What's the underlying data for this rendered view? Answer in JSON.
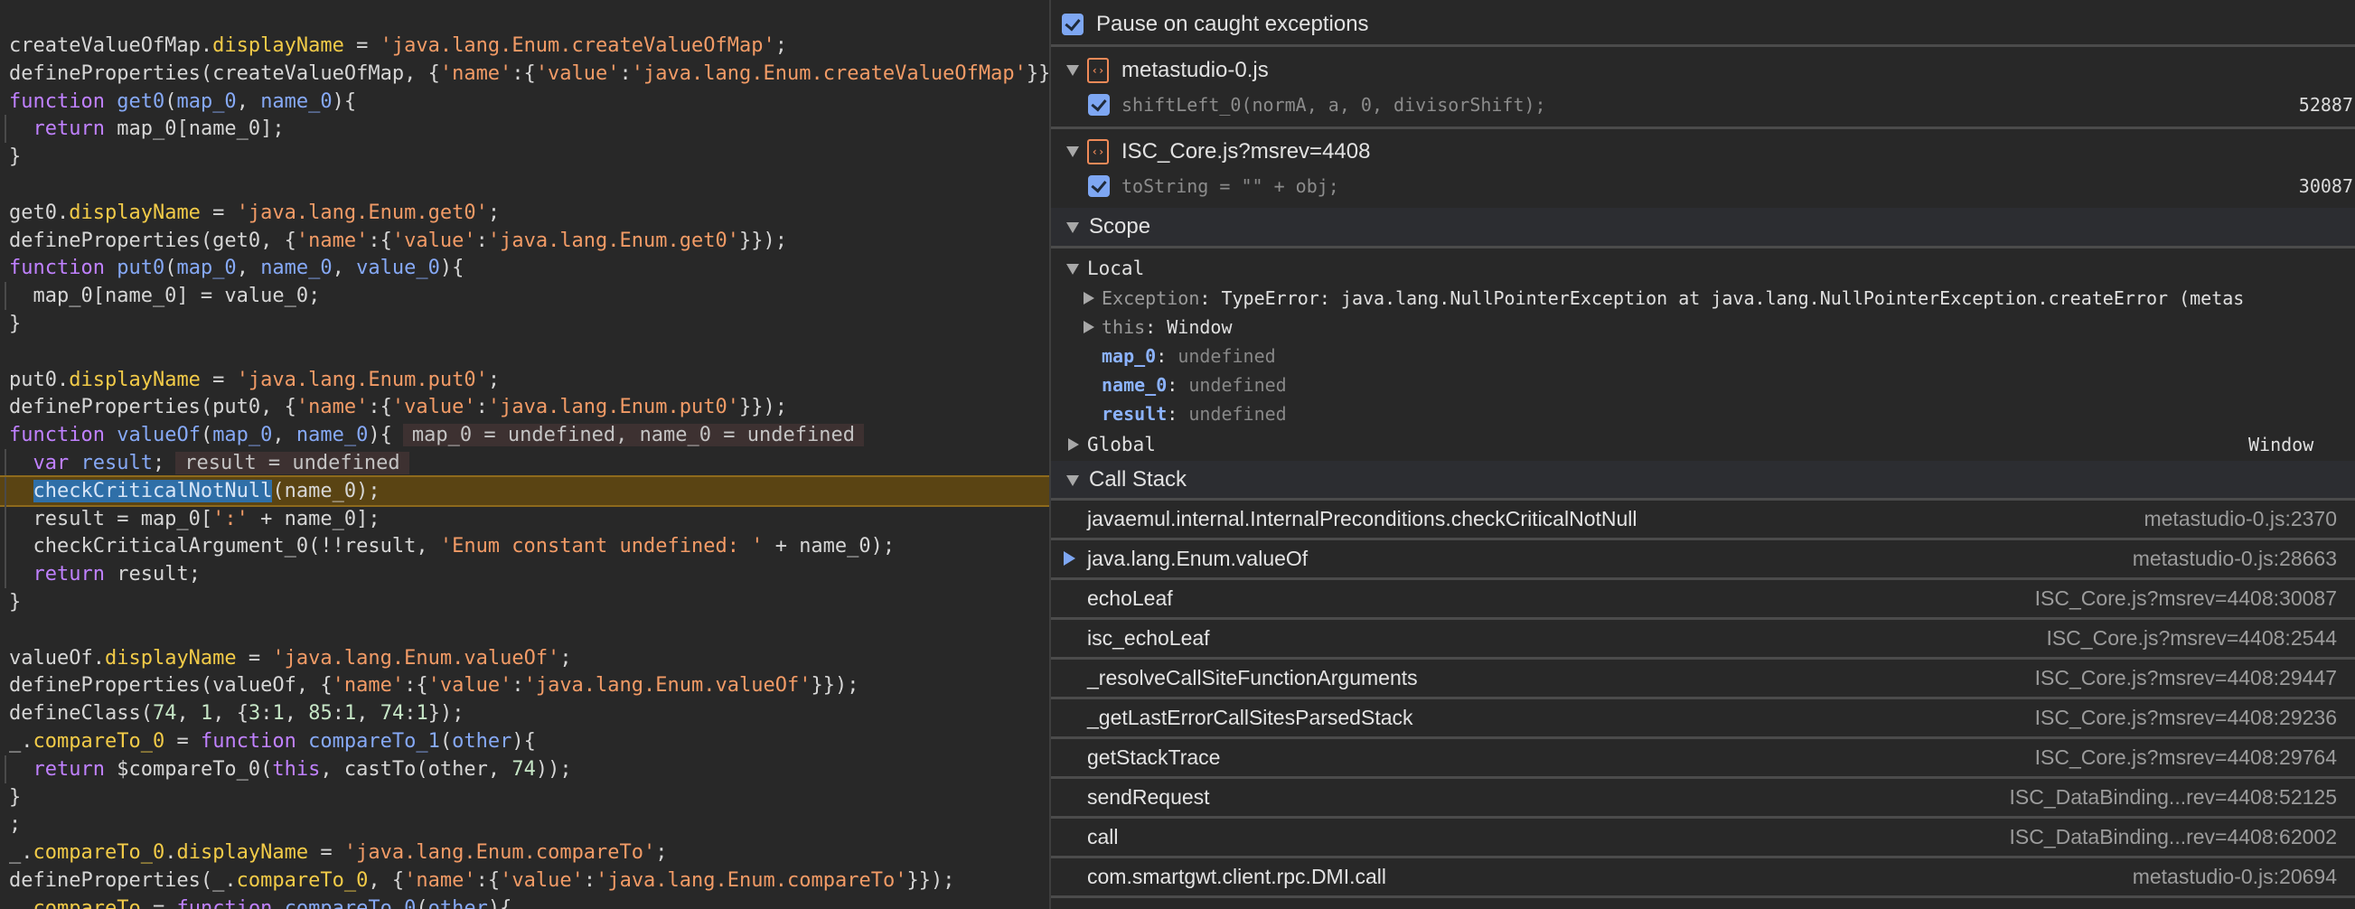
{
  "editor": {
    "executing_line_index": 16,
    "lines": [
      {
        "indent": false,
        "tokens": [
          [
            "p",
            "createValueOfMap."
          ],
          [
            "y",
            "displayName"
          ],
          [
            "p",
            " = "
          ],
          [
            "s",
            "'java.lang.Enum.createValueOfMap'"
          ],
          [
            "p",
            ";"
          ]
        ]
      },
      {
        "indent": false,
        "tokens": [
          [
            "p",
            "defineProperties(createValueOfMap, {"
          ],
          [
            "s",
            "'name'"
          ],
          [
            "p",
            ":{"
          ],
          [
            "s",
            "'value'"
          ],
          [
            "p",
            ":"
          ],
          [
            "s",
            "'java.lang.Enum.createValueOfMap'"
          ],
          [
            "p",
            "}});"
          ]
        ]
      },
      {
        "indent": false,
        "tokens": [
          [
            "k",
            "function "
          ],
          [
            "f",
            "get0"
          ],
          [
            "p",
            "("
          ],
          [
            "f",
            "map_0"
          ],
          [
            "p",
            ", "
          ],
          [
            "f",
            "name_0"
          ],
          [
            "p",
            "){"
          ]
        ]
      },
      {
        "indent": true,
        "tokens": [
          [
            "p",
            "  "
          ],
          [
            "k",
            "return"
          ],
          [
            "p",
            " map_0[name_0];"
          ]
        ]
      },
      {
        "indent": false,
        "tokens": [
          [
            "p",
            "}"
          ]
        ]
      },
      {
        "indent": false,
        "tokens": []
      },
      {
        "indent": false,
        "tokens": [
          [
            "p",
            "get0."
          ],
          [
            "y",
            "displayName"
          ],
          [
            "p",
            " = "
          ],
          [
            "s",
            "'java.lang.Enum.get0'"
          ],
          [
            "p",
            ";"
          ]
        ]
      },
      {
        "indent": false,
        "tokens": [
          [
            "p",
            "defineProperties(get0, {"
          ],
          [
            "s",
            "'name'"
          ],
          [
            "p",
            ":{"
          ],
          [
            "s",
            "'value'"
          ],
          [
            "p",
            ":"
          ],
          [
            "s",
            "'java.lang.Enum.get0'"
          ],
          [
            "p",
            "}});"
          ]
        ]
      },
      {
        "indent": false,
        "tokens": [
          [
            "k",
            "function "
          ],
          [
            "f",
            "put0"
          ],
          [
            "p",
            "("
          ],
          [
            "f",
            "map_0"
          ],
          [
            "p",
            ", "
          ],
          [
            "f",
            "name_0"
          ],
          [
            "p",
            ", "
          ],
          [
            "f",
            "value_0"
          ],
          [
            "p",
            "){"
          ]
        ]
      },
      {
        "indent": true,
        "tokens": [
          [
            "p",
            "  map_0[name_0] = value_0;"
          ]
        ]
      },
      {
        "indent": false,
        "tokens": [
          [
            "p",
            "}"
          ]
        ]
      },
      {
        "indent": false,
        "tokens": []
      },
      {
        "indent": false,
        "tokens": [
          [
            "p",
            "put0."
          ],
          [
            "y",
            "displayName"
          ],
          [
            "p",
            " = "
          ],
          [
            "s",
            "'java.lang.Enum.put0'"
          ],
          [
            "p",
            ";"
          ]
        ]
      },
      {
        "indent": false,
        "tokens": [
          [
            "p",
            "defineProperties(put0, {"
          ],
          [
            "s",
            "'name'"
          ],
          [
            "p",
            ":{"
          ],
          [
            "s",
            "'value'"
          ],
          [
            "p",
            ":"
          ],
          [
            "s",
            "'java.lang.Enum.put0'"
          ],
          [
            "p",
            "}});"
          ]
        ]
      },
      {
        "indent": false,
        "tokens": [
          [
            "k",
            "function "
          ],
          [
            "f",
            "valueOf"
          ],
          [
            "p",
            "("
          ],
          [
            "f",
            "map_0"
          ],
          [
            "p",
            ", "
          ],
          [
            "f",
            "name_0"
          ],
          [
            "p",
            "){"
          ],
          [
            "hint",
            "map_0 = undefined, name_0 = undefined"
          ]
        ]
      },
      {
        "indent": true,
        "tokens": [
          [
            "p",
            "  "
          ],
          [
            "k",
            "var "
          ],
          [
            "f",
            "result"
          ],
          [
            "p",
            ";"
          ],
          [
            "hint",
            "result = undefined"
          ]
        ]
      },
      {
        "indent": true,
        "tokens": [
          [
            "p",
            "  "
          ],
          [
            "sel",
            "checkCriticalNotNull"
          ],
          [
            "p",
            "(name_0);"
          ]
        ]
      },
      {
        "indent": true,
        "tokens": [
          [
            "p",
            "  result = map_0["
          ],
          [
            "s",
            "':'"
          ],
          [
            "p",
            " + name_0];"
          ]
        ]
      },
      {
        "indent": true,
        "tokens": [
          [
            "p",
            "  checkCriticalArgument_0(!!result, "
          ],
          [
            "s",
            "'Enum constant undefined: '"
          ],
          [
            "p",
            " + name_0);"
          ]
        ]
      },
      {
        "indent": true,
        "tokens": [
          [
            "p",
            "  "
          ],
          [
            "k",
            "return"
          ],
          [
            "p",
            " result;"
          ]
        ]
      },
      {
        "indent": false,
        "tokens": [
          [
            "p",
            "}"
          ]
        ]
      },
      {
        "indent": false,
        "tokens": []
      },
      {
        "indent": false,
        "tokens": [
          [
            "p",
            "valueOf."
          ],
          [
            "y",
            "displayName"
          ],
          [
            "p",
            " = "
          ],
          [
            "s",
            "'java.lang.Enum.valueOf'"
          ],
          [
            "p",
            ";"
          ]
        ]
      },
      {
        "indent": false,
        "tokens": [
          [
            "p",
            "defineProperties(valueOf, {"
          ],
          [
            "s",
            "'name'"
          ],
          [
            "p",
            ":{"
          ],
          [
            "s",
            "'value'"
          ],
          [
            "p",
            ":"
          ],
          [
            "s",
            "'java.lang.Enum.valueOf'"
          ],
          [
            "p",
            "}});"
          ]
        ]
      },
      {
        "indent": false,
        "tokens": [
          [
            "p",
            "defineClass("
          ],
          [
            "n",
            "74"
          ],
          [
            "p",
            ", "
          ],
          [
            "n",
            "1"
          ],
          [
            "p",
            ", {"
          ],
          [
            "n",
            "3"
          ],
          [
            "p",
            ":"
          ],
          [
            "n",
            "1"
          ],
          [
            "p",
            ", "
          ],
          [
            "n",
            "85"
          ],
          [
            "p",
            ":"
          ],
          [
            "n",
            "1"
          ],
          [
            "p",
            ", "
          ],
          [
            "n",
            "74"
          ],
          [
            "p",
            ":"
          ],
          [
            "n",
            "1"
          ],
          [
            "p",
            "});"
          ]
        ]
      },
      {
        "indent": false,
        "tokens": [
          [
            "p",
            "_."
          ],
          [
            "y",
            "compareTo_0"
          ],
          [
            "p",
            " = "
          ],
          [
            "k",
            "function "
          ],
          [
            "f",
            "compareTo_1"
          ],
          [
            "p",
            "("
          ],
          [
            "f",
            "other"
          ],
          [
            "p",
            "){"
          ]
        ]
      },
      {
        "indent": true,
        "tokens": [
          [
            "p",
            "  "
          ],
          [
            "k",
            "return"
          ],
          [
            "p",
            " $compareTo_0("
          ],
          [
            "k",
            "this"
          ],
          [
            "p",
            ", castTo(other, "
          ],
          [
            "n",
            "74"
          ],
          [
            "p",
            "));"
          ]
        ]
      },
      {
        "indent": false,
        "tokens": [
          [
            "p",
            "}"
          ]
        ]
      },
      {
        "indent": false,
        "tokens": [
          [
            "p",
            ";"
          ]
        ]
      },
      {
        "indent": false,
        "tokens": [
          [
            "p",
            "_."
          ],
          [
            "y",
            "compareTo_0"
          ],
          [
            "p",
            "."
          ],
          [
            "y",
            "displayName"
          ],
          [
            "p",
            " = "
          ],
          [
            "s",
            "'java.lang.Enum.compareTo'"
          ],
          [
            "p",
            ";"
          ]
        ]
      },
      {
        "indent": false,
        "tokens": [
          [
            "p",
            "defineProperties(_."
          ],
          [
            "y",
            "compareTo_0"
          ],
          [
            "p",
            ", {"
          ],
          [
            "s",
            "'name'"
          ],
          [
            "p",
            ":{"
          ],
          [
            "s",
            "'value'"
          ],
          [
            "p",
            ":"
          ],
          [
            "s",
            "'java.lang.Enum.compareTo'"
          ],
          [
            "p",
            "}});"
          ]
        ]
      },
      {
        "indent": false,
        "tokens": [
          [
            "p",
            "  "
          ],
          [
            "y",
            "compareTo"
          ],
          [
            "p",
            " = "
          ],
          [
            "k",
            "function "
          ],
          [
            "f",
            "compareTo_0"
          ],
          [
            "p",
            "("
          ],
          [
            "f",
            "other"
          ],
          [
            "p",
            "){"
          ]
        ]
      }
    ]
  },
  "breakpoints": {
    "pause_on_caught": {
      "label": "Pause on caught exceptions",
      "checked": true
    },
    "files": [
      {
        "name": "metastudio-0.js",
        "icon": "file-code-icon",
        "entries": [
          {
            "code": "shiftLeft_0(normA, a, 0, divisorShift);",
            "line": "52887",
            "checked": true
          }
        ]
      },
      {
        "name": "ISC_Core.js?msrev=4408",
        "icon": "file-code-icon",
        "entries": [
          {
            "code": "toString = \"\" + obj;",
            "line": "30087",
            "checked": true
          }
        ]
      }
    ]
  },
  "scope": {
    "title": "Scope",
    "local_label": "Local",
    "exception": {
      "key": "Exception",
      "value": "TypeError: java.lang.NullPointerException at java.lang.NullPointerException.createError (metas"
    },
    "this": {
      "key": "this",
      "value": "Window"
    },
    "vars": [
      {
        "key": "map_0",
        "value": "undefined"
      },
      {
        "key": "name_0",
        "value": "undefined"
      },
      {
        "key": "result",
        "value": "undefined"
      }
    ],
    "global": {
      "key": "Global",
      "value": "Window"
    }
  },
  "call_stack": {
    "title": "Call Stack",
    "current_index": 1,
    "frames": [
      {
        "name": "javaemul.internal.InternalPreconditions.checkCriticalNotNull",
        "location": "metastudio-0.js:2370"
      },
      {
        "name": "java.lang.Enum.valueOf",
        "location": "metastudio-0.js:28663"
      },
      {
        "name": "echoLeaf",
        "location": "ISC_Core.js?msrev=4408:30087"
      },
      {
        "name": "isc_echoLeaf",
        "location": "ISC_Core.js?msrev=4408:2544"
      },
      {
        "name": "_resolveCallSiteFunctionArguments",
        "location": "ISC_Core.js?msrev=4408:29447"
      },
      {
        "name": "_getLastErrorCallSitesParsedStack",
        "location": "ISC_Core.js?msrev=4408:29236"
      },
      {
        "name": "getStackTrace",
        "location": "ISC_Core.js?msrev=4408:29764"
      },
      {
        "name": "sendRequest",
        "location": "ISC_DataBinding...rev=4408:52125"
      },
      {
        "name": "call",
        "location": "ISC_DataBinding...rev=4408:62002"
      },
      {
        "name": "com.smartgwt.client.rpc.DMI.call",
        "location": "metastudio-0.js:20694"
      }
    ]
  },
  "colors": {
    "accent": "#7ea7f3",
    "execution_line": "#5a4413",
    "file_icon": "#ef8a58"
  }
}
